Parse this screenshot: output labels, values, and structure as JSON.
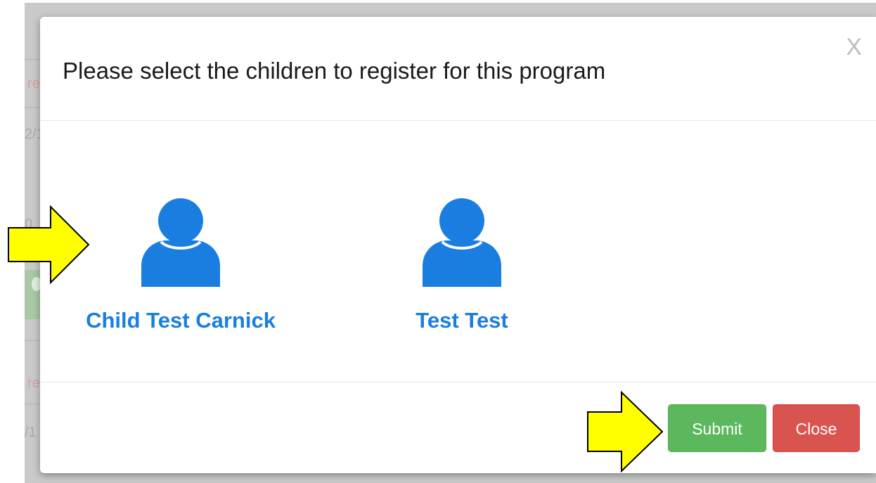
{
  "modal": {
    "title": "Please select the children to register for this program",
    "close_x": "X"
  },
  "children": [
    {
      "name": "Child Test Carnick",
      "icon": "user-icon"
    },
    {
      "name": "Test Test",
      "icon": "user-icon"
    }
  ],
  "footer": {
    "submit_label": "Submit",
    "close_label": "Close"
  },
  "background_fragments": {
    "red_1": "re",
    "gray_1": "2/1",
    "gray_2": "0",
    "red_2": "re",
    "gray_3": "/1"
  },
  "colors": {
    "accent_blue": "#1a7ee0",
    "submit_green": "#5cb85c",
    "close_red": "#d9534f",
    "annotation_yellow": "#ffff00"
  }
}
